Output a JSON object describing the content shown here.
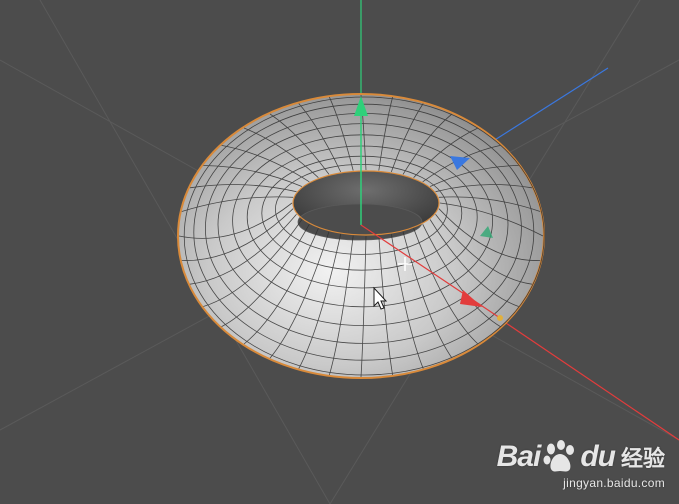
{
  "viewport": {
    "background": "#4c4c4c",
    "object": "torus",
    "axis_colors": {
      "y": "#2fd07a",
      "x": "#e23c3c",
      "z": "#3a78e0"
    },
    "selection_outline": "#d98a3a",
    "icons": [
      "move-gizmo-y-arrow-icon",
      "move-gizmo-x-arrow-icon",
      "move-gizmo-z-arrow-icon",
      "crosshair-icon",
      "mouse-pointer-icon"
    ]
  },
  "watermark": {
    "brand_left": "Bai",
    "brand_right": "du",
    "product": "经验",
    "url": "jingyan.baidu.com"
  }
}
